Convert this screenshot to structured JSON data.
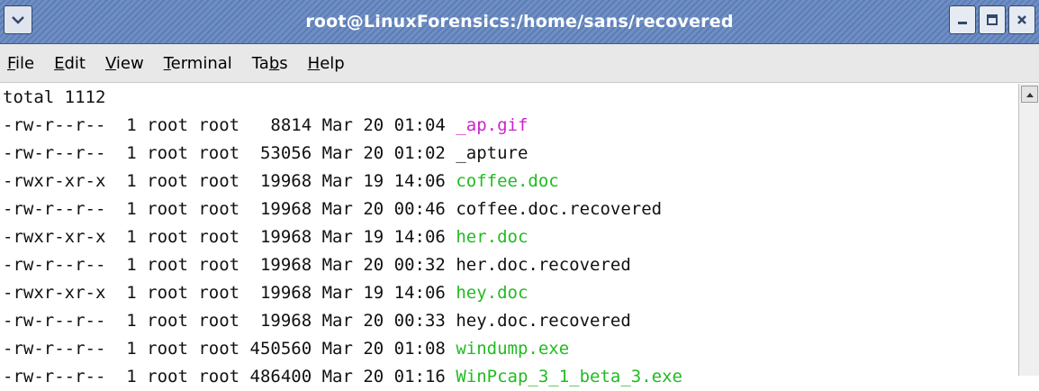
{
  "window": {
    "title": "root@LinuxForensics:/home/sans/recovered"
  },
  "menu": [
    {
      "pre": "",
      "ul": "F",
      "post": "ile"
    },
    {
      "pre": "",
      "ul": "E",
      "post": "dit"
    },
    {
      "pre": "",
      "ul": "V",
      "post": "iew"
    },
    {
      "pre": "",
      "ul": "T",
      "post": "erminal"
    },
    {
      "pre": "Ta",
      "ul": "b",
      "post": "s"
    },
    {
      "pre": "",
      "ul": "H",
      "post": "elp"
    }
  ],
  "terminal": {
    "header": "total 1112",
    "rows": [
      {
        "meta": "-rw-r--r--  1 root root   8814 Mar 20 01:04 ",
        "name": "_ap.gif",
        "color": "#cc22cc"
      },
      {
        "meta": "-rw-r--r--  1 root root  53056 Mar 20 01:02 ",
        "name": "_apture",
        "color": "#111111"
      },
      {
        "meta": "-rwxr-xr-x  1 root root  19968 Mar 19 14:06 ",
        "name": "coffee.doc",
        "color": "#22bb22"
      },
      {
        "meta": "-rw-r--r--  1 root root  19968 Mar 20 00:46 ",
        "name": "coffee.doc.recovered",
        "color": "#111111"
      },
      {
        "meta": "-rwxr-xr-x  1 root root  19968 Mar 19 14:06 ",
        "name": "her.doc",
        "color": "#22bb22"
      },
      {
        "meta": "-rw-r--r--  1 root root  19968 Mar 20 00:32 ",
        "name": "her.doc.recovered",
        "color": "#111111"
      },
      {
        "meta": "-rwxr-xr-x  1 root root  19968 Mar 19 14:06 ",
        "name": "hey.doc",
        "color": "#22bb22"
      },
      {
        "meta": "-rw-r--r--  1 root root  19968 Mar 20 00:33 ",
        "name": "hey.doc.recovered",
        "color": "#111111"
      },
      {
        "meta": "-rw-r--r--  1 root root 450560 Mar 20 01:08 ",
        "name": "windump.exe",
        "color": "#22bb22"
      },
      {
        "meta": "-rw-r--r--  1 root root 486400 Mar 20 01:16 ",
        "name": "WinPcap_3_1_beta_3.exe",
        "color": "#22bb22"
      }
    ]
  },
  "icons": {
    "window_menu": "chevron-down-icon",
    "minimize": "minimize-icon",
    "maximize": "maximize-icon",
    "close": "close-icon",
    "scroll_up": "arrow-up-icon"
  }
}
